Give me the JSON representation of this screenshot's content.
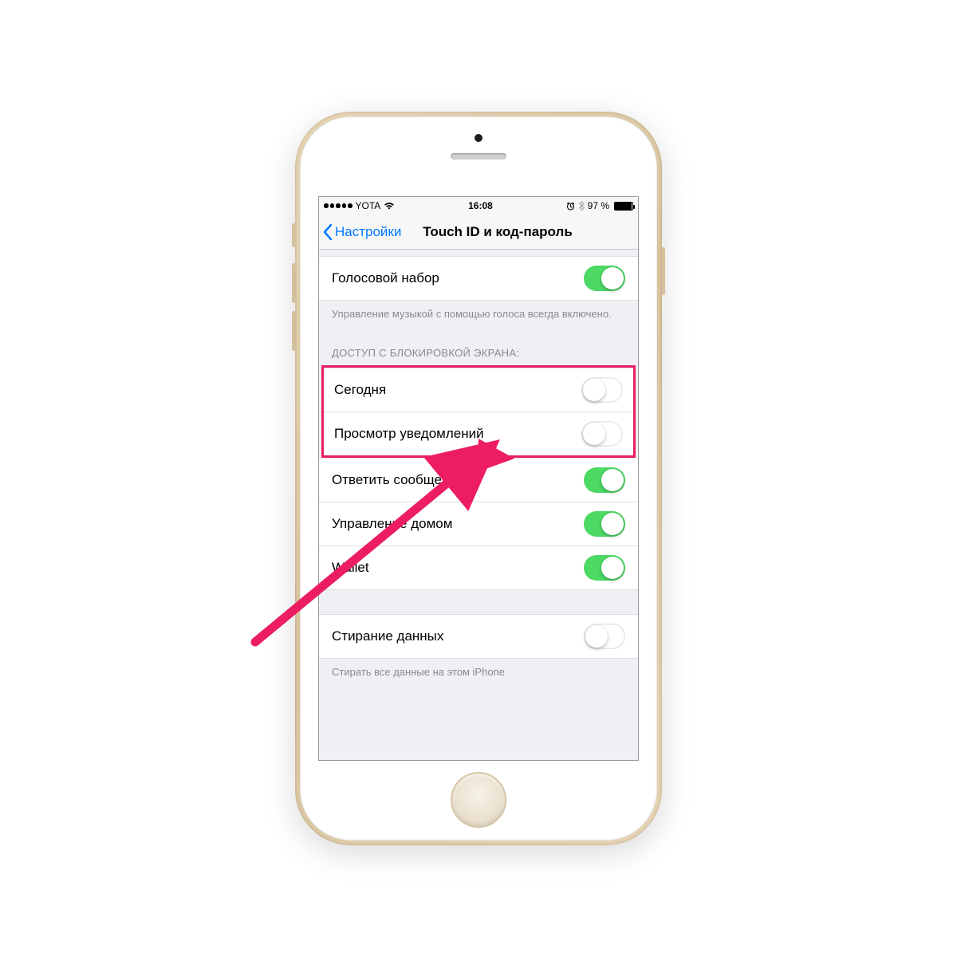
{
  "status": {
    "carrier": "YOTA",
    "time": "16:08",
    "battery_pct": "97 %"
  },
  "nav": {
    "back_label": "Настройки",
    "title": "Touch ID и код-пароль"
  },
  "voice_dial": {
    "label": "Голосовой набор",
    "on": true
  },
  "voice_footer": "Управление музыкой с помощью голоса всегда включено.",
  "lock_header": "ДОСТУП С БЛОКИРОВКОЙ ЭКРАНА:",
  "lock_items": [
    {
      "label": "Сегодня",
      "on": false
    },
    {
      "label": "Просмотр уведомлений",
      "on": false
    },
    {
      "label": "Ответить сообщением",
      "on": true
    },
    {
      "label": "Управление домом",
      "on": true
    },
    {
      "label": "Wallet",
      "on": true
    }
  ],
  "erase": {
    "label": "Стирание данных",
    "on": false
  },
  "erase_footer": "Стирать все данные на этом iPhone"
}
